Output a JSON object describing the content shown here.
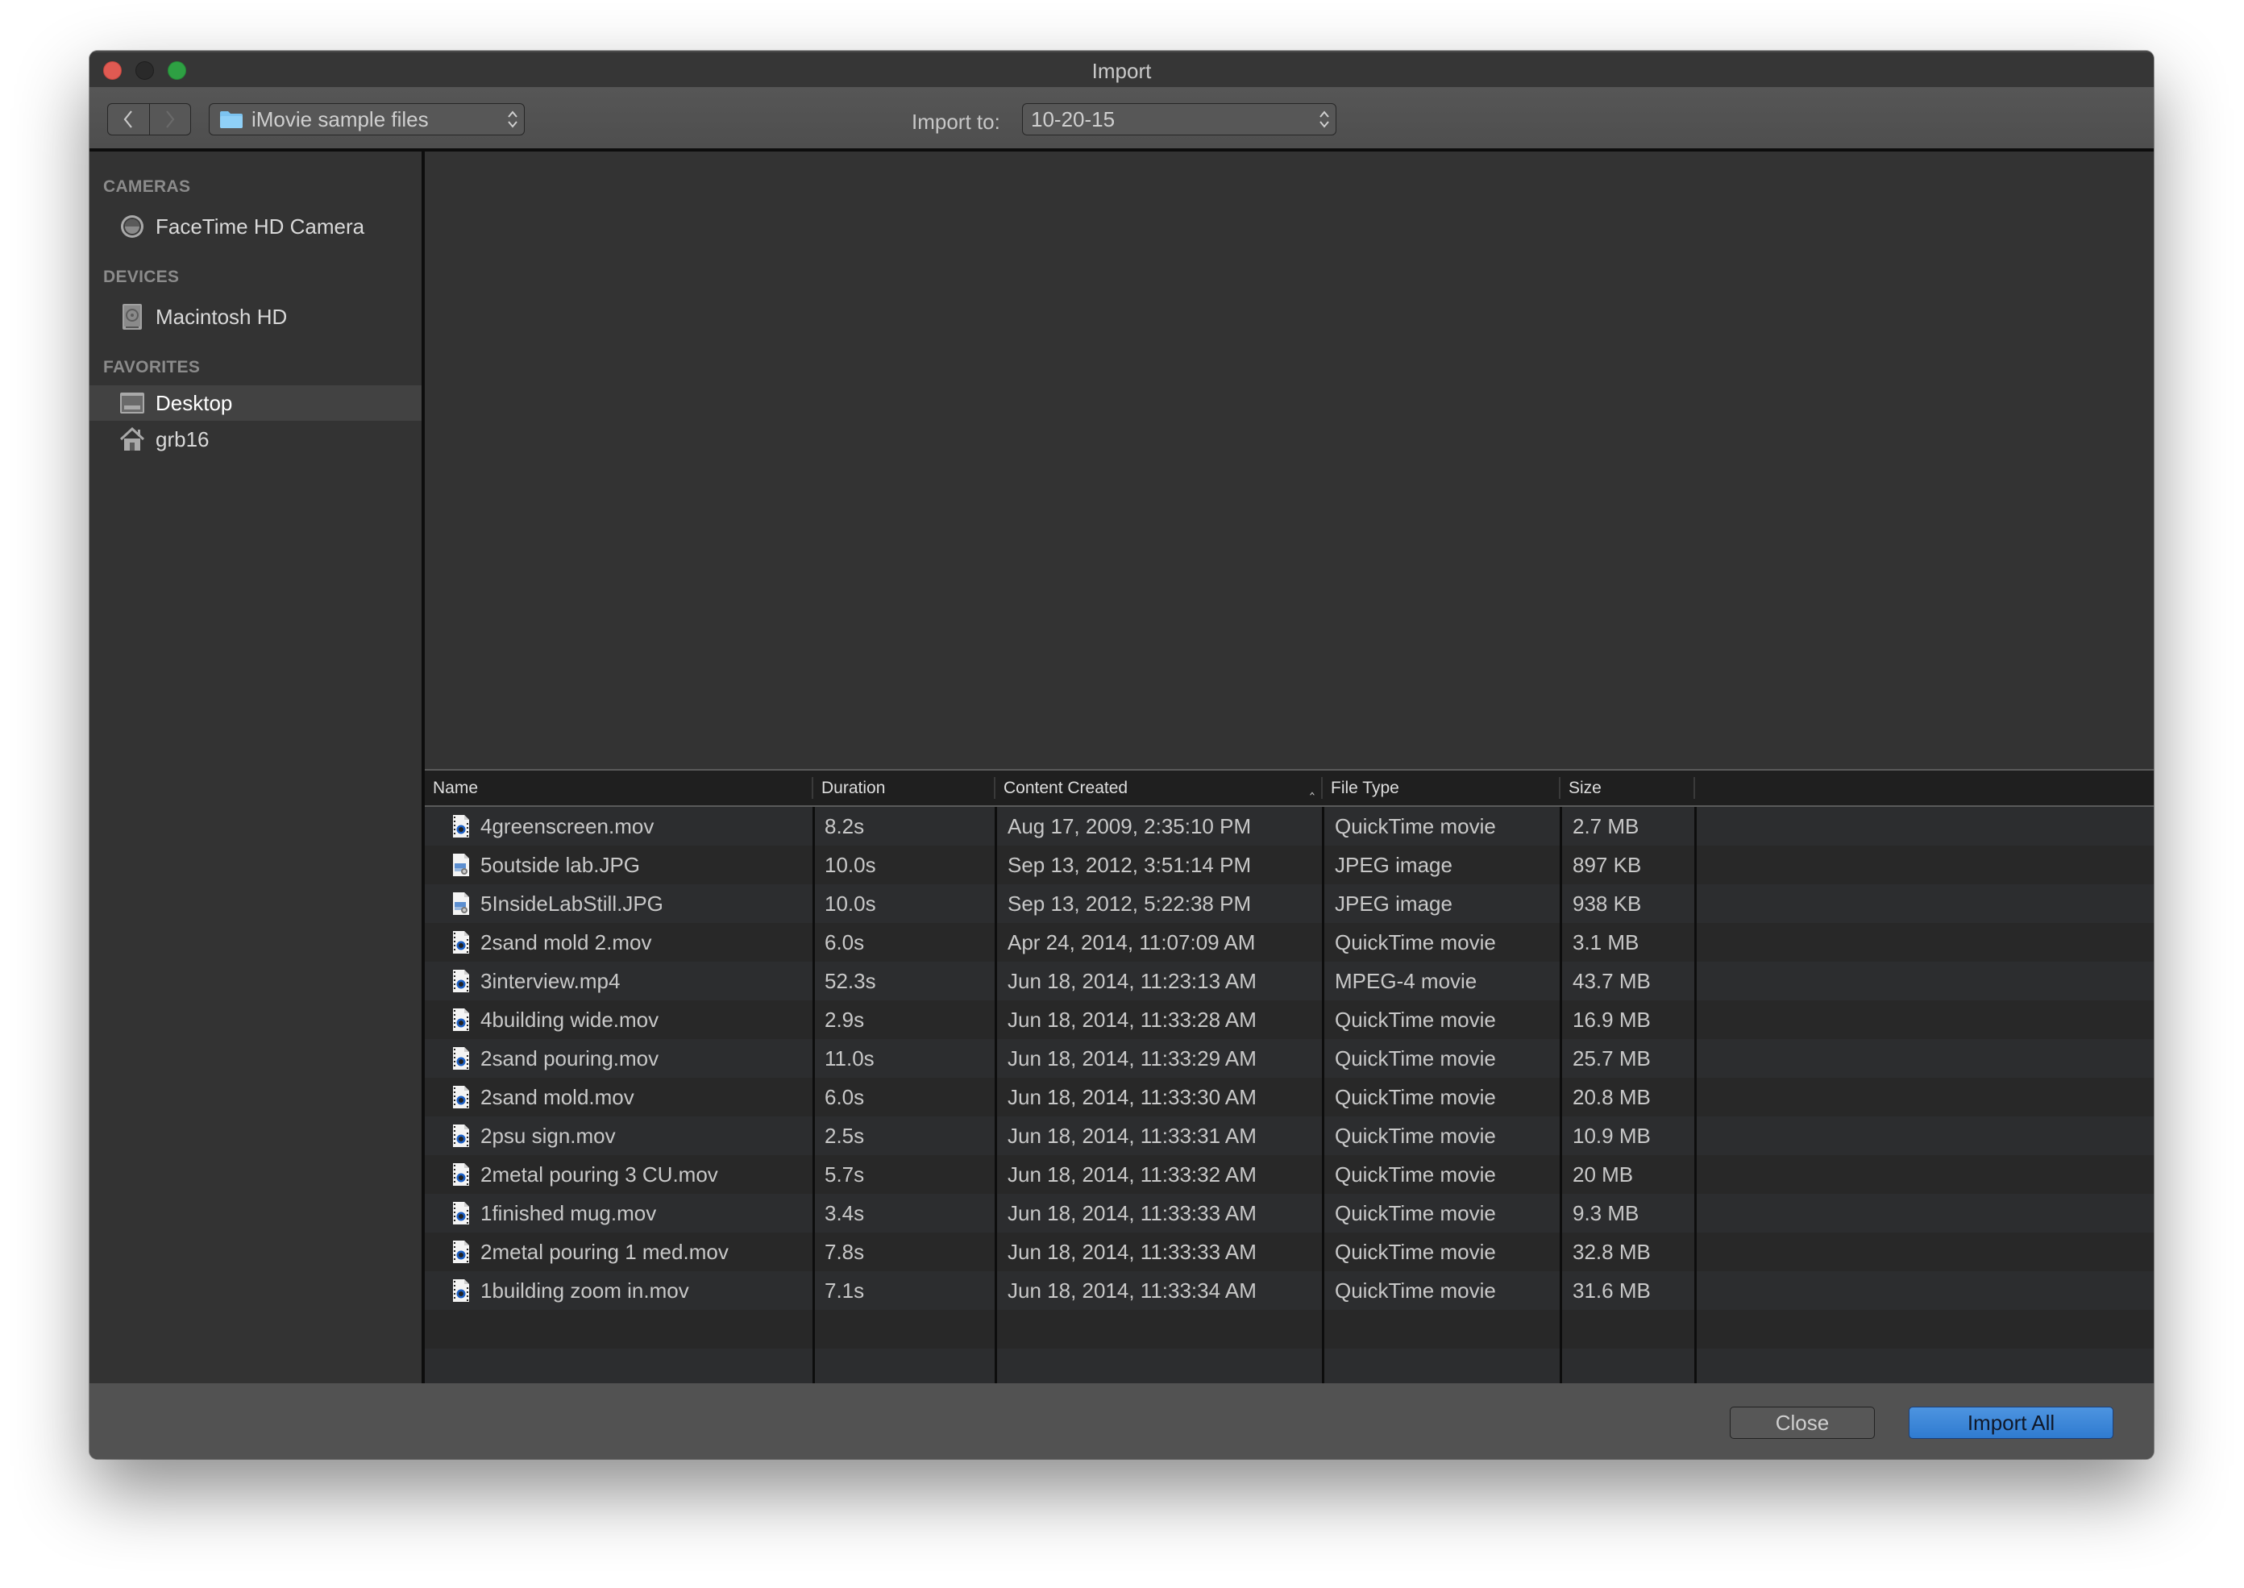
{
  "window": {
    "title": "Import",
    "traffic_lights": [
      "close",
      "minimize",
      "zoom"
    ]
  },
  "toolbar": {
    "back_icon": "chevron-left-icon",
    "forward_icon": "chevron-right-icon",
    "source_folder": "iMovie sample files",
    "source_folder_icon": "folder-icon",
    "import_to_label": "Import to:",
    "import_to_value": "10-20-15"
  },
  "sidebar": {
    "sections": [
      {
        "heading": "CAMERAS",
        "items": [
          {
            "label": "FaceTime HD Camera",
            "icon": "camera-icon",
            "selected": false
          }
        ]
      },
      {
        "heading": "DEVICES",
        "items": [
          {
            "label": "Macintosh HD",
            "icon": "hard-drive-icon",
            "selected": false
          }
        ]
      },
      {
        "heading": "FAVORITES",
        "items": [
          {
            "label": "Desktop",
            "icon": "desktop-icon",
            "selected": true
          },
          {
            "label": "grb16",
            "icon": "home-icon",
            "selected": false
          }
        ]
      }
    ]
  },
  "list": {
    "columns": [
      "Name",
      "Duration",
      "Content Created",
      "File Type",
      "Size"
    ],
    "sorted_column": "Content Created",
    "sort_direction": "ascending",
    "rows": [
      {
        "name": "4greenscreen.mov",
        "kind": "movie",
        "duration": "8.2s",
        "created": "Aug 17, 2009, 2:35:10 PM",
        "type": "QuickTime movie",
        "size": "2.7 MB"
      },
      {
        "name": "5outside lab.JPG",
        "kind": "image",
        "duration": "10.0s",
        "created": "Sep 13, 2012, 3:51:14 PM",
        "type": "JPEG image",
        "size": "897 KB"
      },
      {
        "name": "5InsideLabStill.JPG",
        "kind": "image",
        "duration": "10.0s",
        "created": "Sep 13, 2012, 5:22:38 PM",
        "type": "JPEG image",
        "size": "938 KB"
      },
      {
        "name": "2sand mold 2.mov",
        "kind": "movie",
        "duration": "6.0s",
        "created": "Apr 24, 2014, 11:07:09 AM",
        "type": "QuickTime movie",
        "size": "3.1 MB"
      },
      {
        "name": "3interview.mp4",
        "kind": "movie",
        "duration": "52.3s",
        "created": "Jun 18, 2014, 11:23:13 AM",
        "type": "MPEG-4 movie",
        "size": "43.7 MB"
      },
      {
        "name": "4building wide.mov",
        "kind": "movie",
        "duration": "2.9s",
        "created": "Jun 18, 2014, 11:33:28 AM",
        "type": "QuickTime movie",
        "size": "16.9 MB"
      },
      {
        "name": "2sand pouring.mov",
        "kind": "movie",
        "duration": "11.0s",
        "created": "Jun 18, 2014, 11:33:29 AM",
        "type": "QuickTime movie",
        "size": "25.7 MB"
      },
      {
        "name": "2sand mold.mov",
        "kind": "movie",
        "duration": "6.0s",
        "created": "Jun 18, 2014, 11:33:30 AM",
        "type": "QuickTime movie",
        "size": "20.8 MB"
      },
      {
        "name": "2psu sign.mov",
        "kind": "movie",
        "duration": "2.5s",
        "created": "Jun 18, 2014, 11:33:31 AM",
        "type": "QuickTime movie",
        "size": "10.9 MB"
      },
      {
        "name": "2metal pouring 3 CU.mov",
        "kind": "movie",
        "duration": "5.7s",
        "created": "Jun 18, 2014, 11:33:32 AM",
        "type": "QuickTime movie",
        "size": "20 MB"
      },
      {
        "name": "1finished mug.mov",
        "kind": "movie",
        "duration": "3.4s",
        "created": "Jun 18, 2014, 11:33:33 AM",
        "type": "QuickTime movie",
        "size": "9.3 MB"
      },
      {
        "name": "2metal pouring 1 med.mov",
        "kind": "movie",
        "duration": "7.8s",
        "created": "Jun 18, 2014, 11:33:33 AM",
        "type": "QuickTime movie",
        "size": "32.8 MB"
      },
      {
        "name": "1building zoom in.mov",
        "kind": "movie",
        "duration": "7.1s",
        "created": "Jun 18, 2014, 11:33:34 AM",
        "type": "QuickTime movie",
        "size": "31.6 MB"
      }
    ]
  },
  "footer": {
    "close_label": "Close",
    "import_all_label": "Import All"
  },
  "colors": {
    "accent": "#2f7bd0",
    "window_bg": "#323232",
    "toolbar_bg": "#525252",
    "selected_sidebar": "#424242"
  }
}
